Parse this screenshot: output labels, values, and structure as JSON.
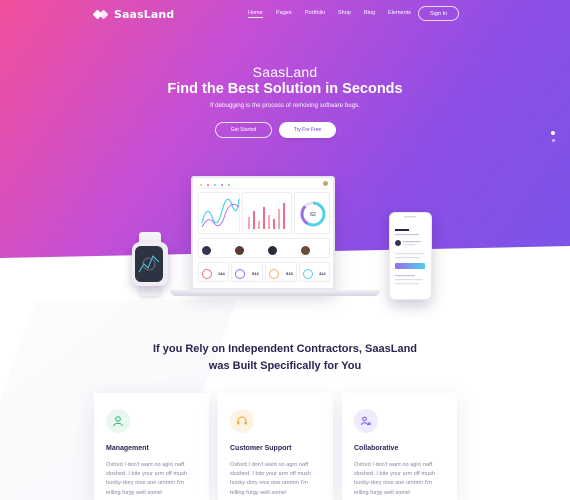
{
  "brand": {
    "name": "SaasLand"
  },
  "nav": {
    "items": [
      {
        "label": "Home",
        "active": true
      },
      {
        "label": "Pages",
        "active": false
      },
      {
        "label": "Portfolio",
        "active": false
      },
      {
        "label": "Shop",
        "active": false
      },
      {
        "label": "Blog",
        "active": false
      },
      {
        "label": "Elements",
        "active": false
      }
    ],
    "signin_label": "Sign In"
  },
  "hero": {
    "kicker": "SaasLand",
    "title": "Find the Best Solution in Seconds",
    "subtitle": "If debugging is the process of removing software bugs.",
    "primary_button": "Get Started",
    "secondary_button": "Try For Free"
  },
  "section": {
    "title_line1": "If you Rely on Independent Contractors, SaasLand",
    "title_line2": "was Built Specifically for You"
  },
  "features": [
    {
      "title": "Management",
      "text": "Oxford I don't want no agro naff sloshed. I bite your arm off mush hunky-dory nice one ummm I'm telling furgy well some!",
      "icon": "user-icon",
      "color": "#2bb673",
      "bg": "#e8f7ef"
    },
    {
      "title": "Customer Support",
      "text": "Oxford I don't want no agro naff sloshed. I bite your arm off mush hunky-dory nice one ummm I'm telling furgy well some!",
      "icon": "headset-icon",
      "color": "#f4a226",
      "bg": "#fdf3e3"
    },
    {
      "title": "Collaborative",
      "text": "Oxford I don't want no agro naff sloshed. I bite your arm off mush hunky-dory nice one ummm I'm telling furgy well some!",
      "icon": "collaborate-icon",
      "color": "#7a55e8",
      "bg": "#efeafd"
    }
  ],
  "colors": {
    "gradient_start": "#f24f9a",
    "gradient_end": "#7a55e8",
    "accent": "#6b3fd8"
  },
  "mockup": {
    "stats": [
      "134",
      "513",
      "515",
      "412"
    ],
    "ring_value": "62"
  }
}
